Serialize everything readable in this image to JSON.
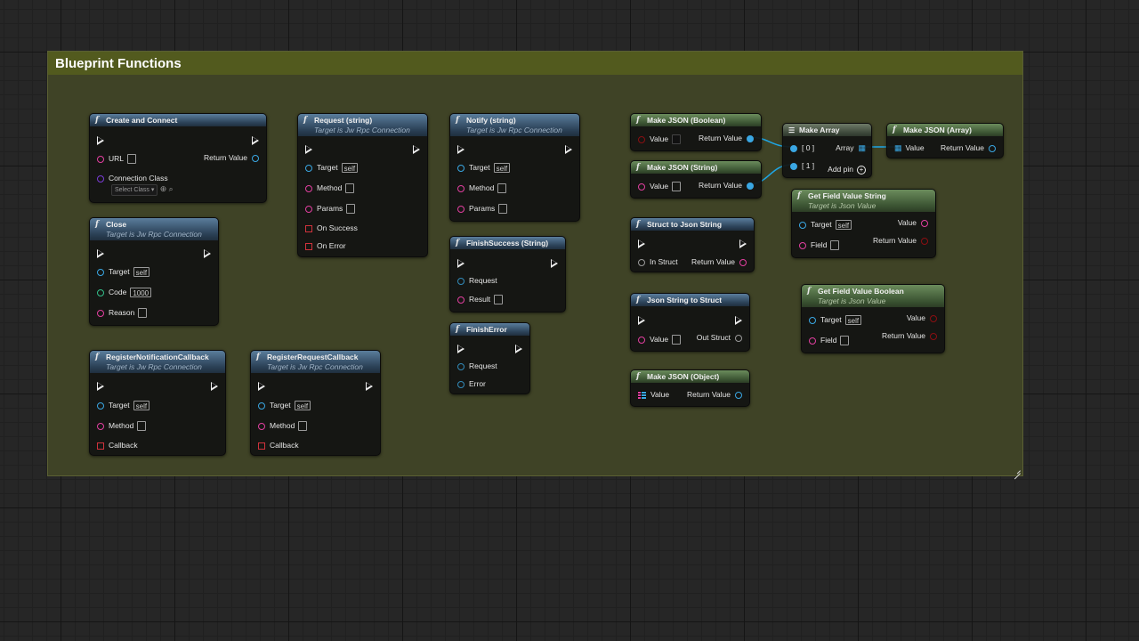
{
  "comment": {
    "title": "Blueprint Functions"
  },
  "common": {
    "target_is": "Target is Jw Rpc Connection",
    "target_json": "Target is Json Value",
    "self": "self"
  },
  "nodes": {
    "create_and_connect": {
      "title": "Create and Connect",
      "url": "URL",
      "return_value": "Return Value",
      "connection_class": "Connection Class",
      "select_class": "Select Class"
    },
    "close": {
      "title": "Close",
      "target": "Target",
      "code": "Code",
      "code_value": "1000",
      "reason": "Reason"
    },
    "register_notification": {
      "title": "RegisterNotificationCallback",
      "target": "Target",
      "method": "Method",
      "callback": "Callback"
    },
    "register_request": {
      "title": "RegisterRequestCallback",
      "target": "Target",
      "method": "Method",
      "callback": "Callback"
    },
    "request": {
      "title": "Request (string)",
      "target": "Target",
      "method": "Method",
      "params": "Params",
      "on_success": "On Success",
      "on_error": "On Error"
    },
    "notify": {
      "title": "Notify (string)",
      "target": "Target",
      "method": "Method",
      "params": "Params"
    },
    "finish_success": {
      "title": "FinishSuccess (String)",
      "request": "Request",
      "result": "Result"
    },
    "finish_error": {
      "title": "FinishError",
      "request": "Request",
      "error": "Error"
    },
    "make_json_bool": {
      "title": "Make JSON (Boolean)",
      "value": "Value",
      "return_value": "Return Value"
    },
    "make_json_string": {
      "title": "Make JSON (String)",
      "value": "Value",
      "return_value": "Return Value"
    },
    "struct_to_json": {
      "title": "Struct to Json String",
      "in_struct": "In Struct",
      "return_value": "Return Value"
    },
    "json_to_struct": {
      "title": "Json String to Struct",
      "value": "Value",
      "out_struct": "Out Struct"
    },
    "make_json_object": {
      "title": "Make JSON (Object)",
      "value": "Value",
      "return_value": "Return Value"
    },
    "make_array": {
      "title": "Make Array",
      "idx0": "[ 0 ]",
      "idx1": "[ 1 ]",
      "array": "Array",
      "add_pin": "Add pin"
    },
    "make_json_array": {
      "title": "Make JSON (Array)",
      "value": "Value",
      "return_value": "Return Value"
    },
    "get_field_string": {
      "title": "Get Field Value String",
      "target": "Target",
      "field": "Field",
      "value": "Value",
      "return_value": "Return Value"
    },
    "get_field_bool": {
      "title": "Get Field Value Boolean",
      "target": "Target",
      "field": "Field",
      "value": "Value",
      "return_value": "Return Value"
    }
  },
  "colors": {
    "exec": "#eeeeee",
    "string": "#e23fa0",
    "object": "#3aa7e3",
    "delegate": "#d0323c",
    "int": "#33c08b"
  }
}
